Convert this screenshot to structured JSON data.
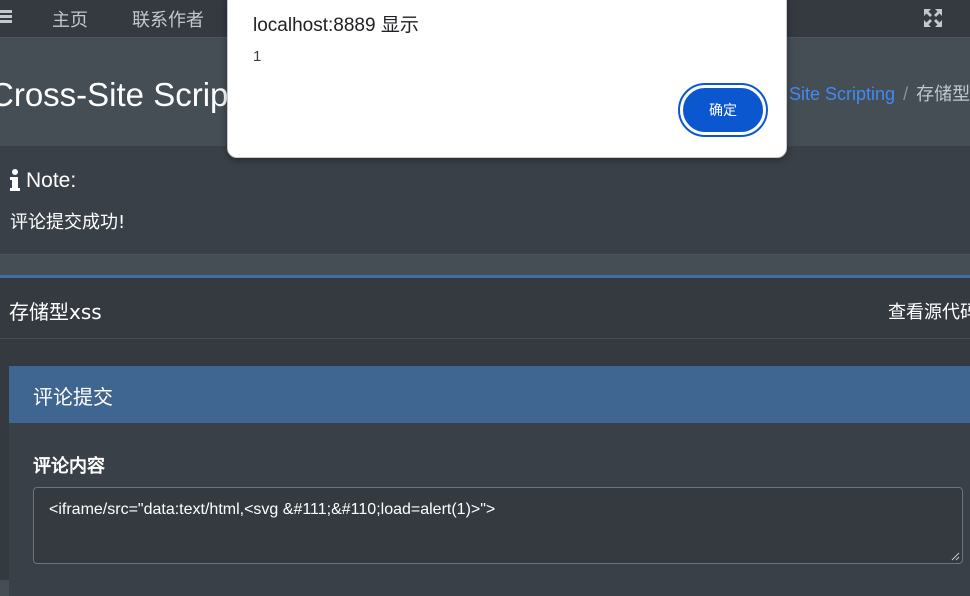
{
  "navbar": {
    "menu_icon": "hamburger-icon",
    "links": [
      "主页",
      "联系作者"
    ],
    "fullscreen_icon": "expand-icon"
  },
  "header": {
    "page_title": "Cross-Site Scripting",
    "breadcrumb": {
      "link": "Site Scripting",
      "separator": "/",
      "active": "存储型"
    }
  },
  "note": {
    "icon": "info-icon",
    "title": "Note:",
    "message": "评论提交成功!"
  },
  "card": {
    "title": "存储型xss",
    "view_source": "查看源代码",
    "form": {
      "section_title": "评论提交",
      "field_label": "评论内容",
      "comment_value": "<iframe/src=\"data:text/html,<svg &#111;&#110;load=alert(1)>\">"
    }
  },
  "alert": {
    "title": "localhost:8889 显示",
    "message": "1",
    "ok_label": "确定"
  },
  "colors": {
    "background": "#454d55",
    "navbar": "#343a40",
    "card_accent": "#3f6ea2",
    "inner_header": "#3f6591",
    "breadcrumb_link": "#3f8cf2",
    "alert_button": "#0b57d0"
  }
}
